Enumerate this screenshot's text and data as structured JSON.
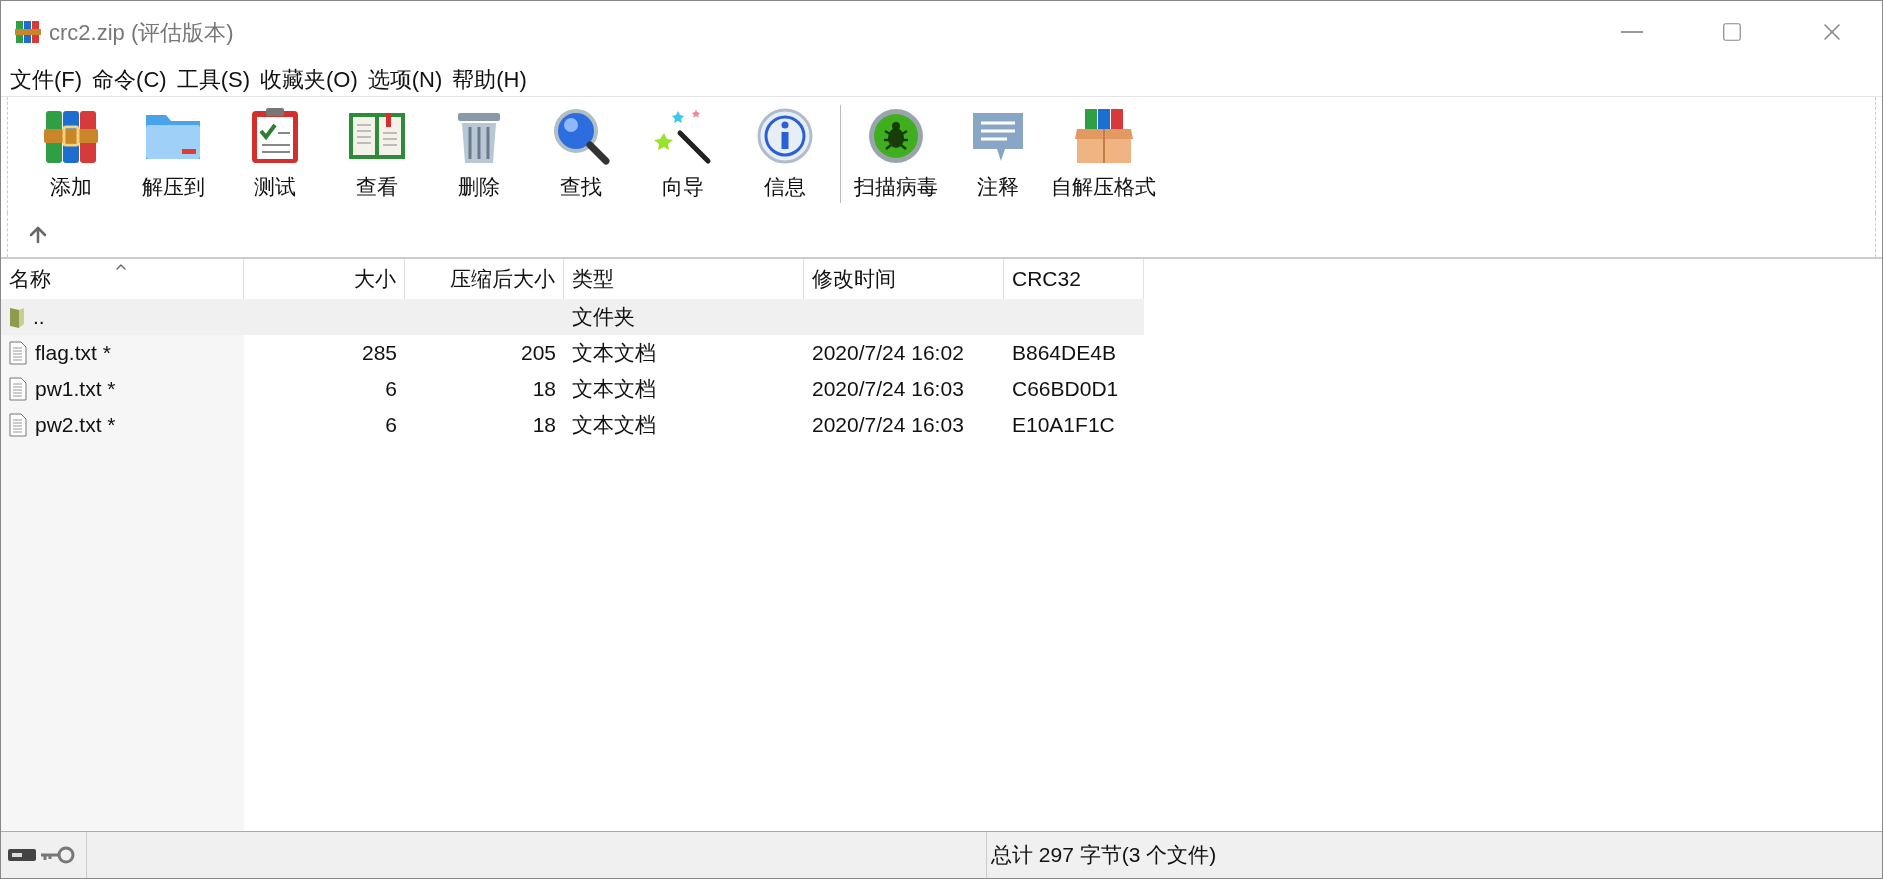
{
  "window": {
    "title": "crc2.zip (评估版本)"
  },
  "menu": [
    "文件(F)",
    "命令(C)",
    "工具(S)",
    "收藏夹(O)",
    "选项(N)",
    "帮助(H)"
  ],
  "toolbar_groups": [
    {
      "buttons": [
        {
          "label": "添加",
          "kind": "books"
        },
        {
          "label": "解压到",
          "kind": "folder"
        },
        {
          "label": "测试",
          "kind": "clipboard"
        },
        {
          "label": "查看",
          "kind": "book"
        },
        {
          "label": "删除",
          "kind": "trash"
        },
        {
          "label": "查找",
          "kind": "magnifier"
        },
        {
          "label": "向导",
          "kind": "wand"
        },
        {
          "label": "信息",
          "kind": "info"
        }
      ]
    },
    {
      "buttons": [
        {
          "label": "扫描病毒",
          "kind": "bug"
        },
        {
          "label": "注释",
          "kind": "comment"
        },
        {
          "label": "自解压格式",
          "kind": "box"
        }
      ]
    }
  ],
  "table": {
    "columns": [
      {
        "label": "名称",
        "sorted": true
      },
      {
        "label": "大小",
        "sorted": false
      },
      {
        "label": "压缩后大小",
        "sorted": false
      },
      {
        "label": "类型",
        "sorted": false
      },
      {
        "label": "修改时间",
        "sorted": false
      },
      {
        "label": "CRC32",
        "sorted": false
      }
    ],
    "rows": [
      {
        "kind": "folder",
        "selected": true,
        "cells": [
          "..",
          "",
          "",
          "文件夹",
          "",
          ""
        ]
      },
      {
        "kind": "file",
        "selected": false,
        "cells": [
          "flag.txt *",
          "285",
          "205",
          "文本文档",
          "2020/7/24 16:02",
          "B864DE4B"
        ]
      },
      {
        "kind": "file",
        "selected": false,
        "cells": [
          "pw1.txt *",
          "6",
          "18",
          "文本文档",
          "2020/7/24 16:03",
          "C66BD0D1"
        ]
      },
      {
        "kind": "file",
        "selected": false,
        "cells": [
          "pw2.txt *",
          "6",
          "18",
          "文本文档",
          "2020/7/24 16:03",
          "E10A1F1C"
        ]
      }
    ]
  },
  "status_bar": {
    "summary": "总计 297 字节(3 个文件)"
  }
}
